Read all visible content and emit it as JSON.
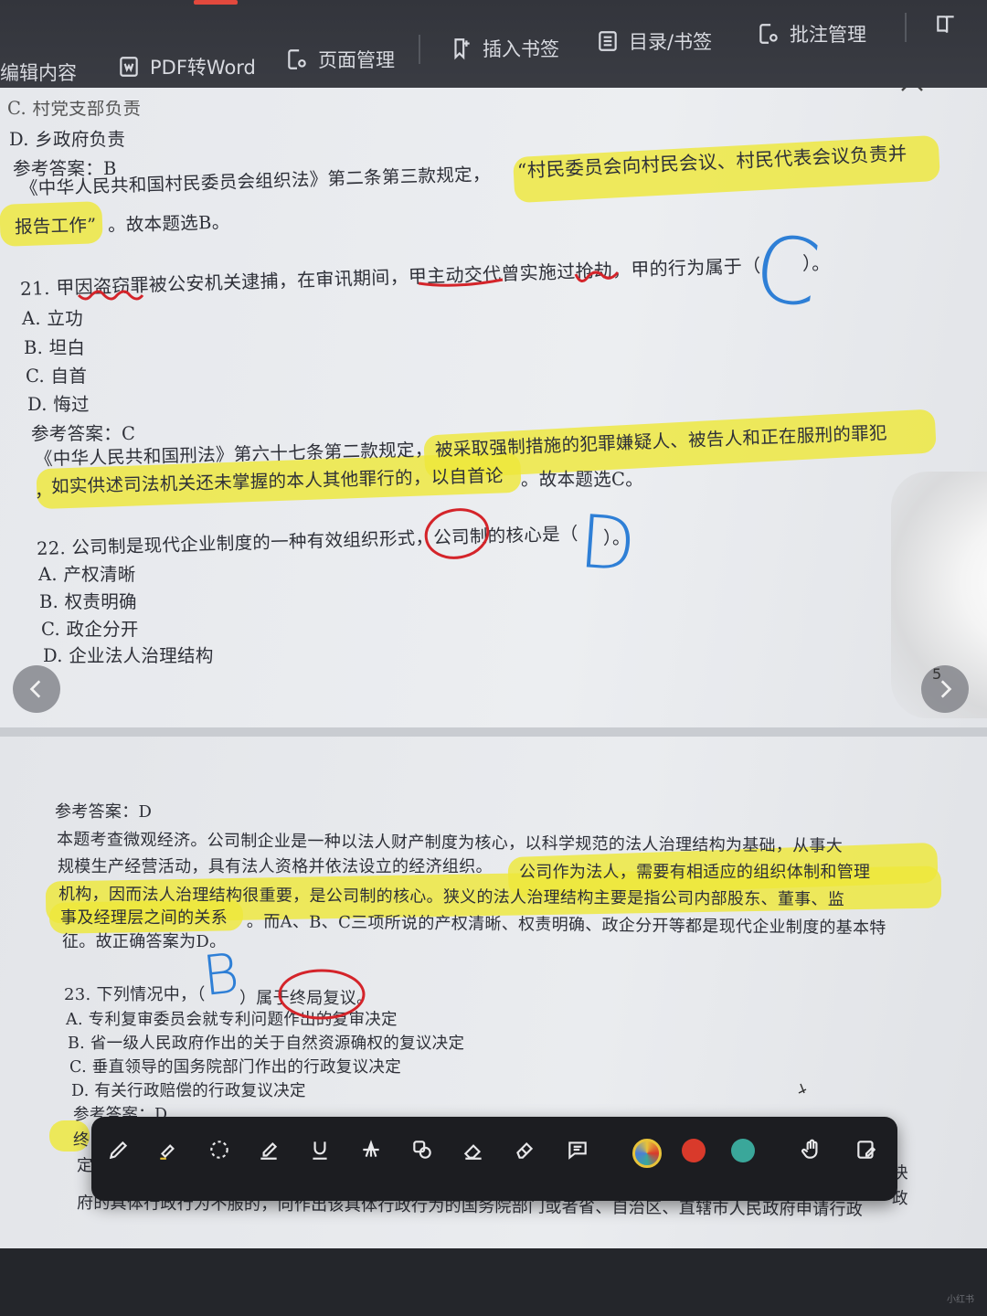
{
  "toolbar": {
    "items": [
      {
        "label": "编辑内容"
      },
      {
        "label": "PDF转Word"
      },
      {
        "label": "页面管理"
      },
      {
        "label": "插入书签"
      },
      {
        "label": "目录/书签"
      },
      {
        "label": "批注管理"
      }
    ]
  },
  "page1": {
    "lines": [
      "C. 村党支部负责",
      "D. 乡政府负责",
      "参考答案：B",
      "《中华人民共和国村民委员会组织法》第二条第三款规定，",
      "“村民委员会向村民会议、村民代表会议负责并",
      "报告工作”",
      "。故本题选B。",
      "21. 甲因盗窃罪被公安机关逮捕，在审讯期间，甲主动交代曾实施过抢劫，甲的行为属于（",
      "）。",
      "A. 立功",
      "B. 坦白",
      "C. 自首",
      "D. 悔过",
      "参考答案：C",
      "《中华人民共和国刑法》第六十七条第二款规定，",
      "被采取强制措施的犯罪嫌疑人、被告人和正在服刑的罪犯",
      "，",
      "如实供述司法机关还未掌握的本人其他罪行的，以自首论",
      "。故本题选C。",
      "22. 公司制是现代企业制度的一种有效组织形式，公司制的核心是（",
      "）。",
      "A. 产权清晰",
      "B. 权责明确",
      "C. 政企分开",
      "D. 企业法人治理结构"
    ],
    "handwritten": [
      "C",
      "D"
    ],
    "page_number": "5"
  },
  "page2": {
    "lines": [
      "参考答案：D",
      "本题考查微观经济。公司制企业是一种以法人财产制度为核心，以科学规范的法人治理结构为基础，从事大",
      "规模生产经营活动，具有法人资格并依法设立的经济组织。",
      "公司作为法人，需要有相适应的组织体制和管理",
      "机构，因而法人治理结构很重要，是公司制的核心。狭义的法人治理结构主要是指公司内部股东、董事、监",
      "事及经理层之间的关系",
      "。而A、B、C三项所说的产权清晰、权责明确、政企分开等都是现代企业制度的基本特",
      "征。故正确答案为D。",
      "23. 下列情况中，（",
      "）属于终局复议。",
      "A. 专利复审委员会就专利问题作出的复审决定",
      "B. 省一级人民政府作出的关于自然资源确权的复议决定",
      "C. 垂直领导的国务院部门作出的行政复议决定",
      "D. 有关行政赔偿的行政复议决定",
      "参考答案：D",
      "终",
      "定",
      "快",
      "政",
      "府的具体行政行为不服的，向作出该具体行政行为的国务院部门或者省、自治区、直辖市人民政府申请行政"
    ],
    "handwritten": [
      "B"
    ]
  },
  "annotation_toolbar": {
    "tools": [
      "pen-icon",
      "highlighter-icon",
      "lasso-icon",
      "marker-icon",
      "underline-icon",
      "strikethrough-icon",
      "shape-icon",
      "eraser-icon",
      "area-eraser-icon",
      "comment-icon"
    ],
    "colors": [
      "#e8c33a",
      "#d93a2b",
      "#3aa79a"
    ],
    "extra_tools": [
      "hand-icon",
      "edit-note-icon"
    ]
  },
  "colors": {
    "highlight": "#eee83a",
    "red_ink": "#d4242a",
    "blue_ink": "#2e7fd6"
  },
  "watermark": "小红书"
}
